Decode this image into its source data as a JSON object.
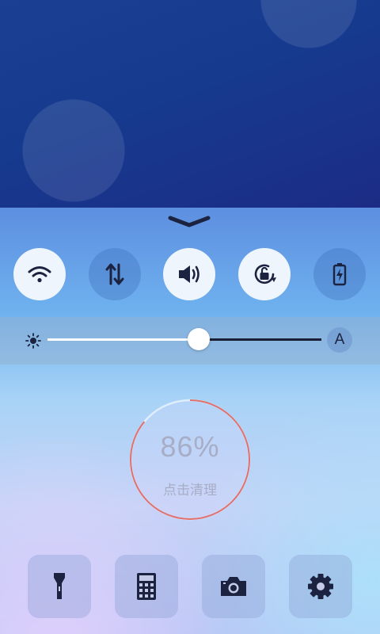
{
  "quick_toggles": [
    {
      "name": "wifi",
      "icon": "wifi-icon",
      "state": "on"
    },
    {
      "name": "mobile-data",
      "icon": "data-arrows-icon",
      "state": "off"
    },
    {
      "name": "sound",
      "icon": "speaker-icon",
      "state": "on"
    },
    {
      "name": "rotation-lock",
      "icon": "rotation-lock-icon",
      "state": "on"
    },
    {
      "name": "power-saving",
      "icon": "battery-charging-icon",
      "state": "off"
    }
  ],
  "brightness": {
    "level": 0.6,
    "auto_label": "A"
  },
  "memory_cleaner": {
    "percent": "86%",
    "action_label": "点击清理",
    "ring_color": "#e0706e"
  },
  "shortcuts": [
    {
      "name": "flashlight",
      "icon": "flashlight-icon"
    },
    {
      "name": "calculator",
      "icon": "calculator-icon"
    },
    {
      "name": "camera",
      "icon": "camera-icon"
    },
    {
      "name": "settings",
      "icon": "gear-icon"
    }
  ],
  "colors": {
    "accent_dark": "#1b2340",
    "toggle_on": "#eef5fd"
  }
}
